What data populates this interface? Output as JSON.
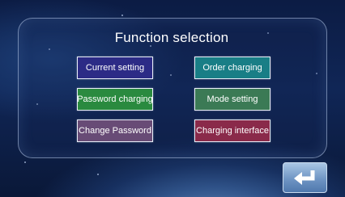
{
  "screen": {
    "title": "Function selection"
  },
  "buttons": [
    {
      "label": "Current setting"
    },
    {
      "label": "Order charging"
    },
    {
      "label": "Password charging"
    },
    {
      "label": "Mode setting"
    },
    {
      "label": "Change Password"
    },
    {
      "label": "Charging interface"
    }
  ],
  "return_button": {
    "icon": "return-arrow-icon"
  },
  "colors": {
    "current_setting": "#2c2b86",
    "order_charging": "#197e86",
    "password_charging": "#2a8a3f",
    "mode_setting": "#3b7a55",
    "change_password": "#684b76",
    "charging_interface": "#8a2a4a"
  }
}
